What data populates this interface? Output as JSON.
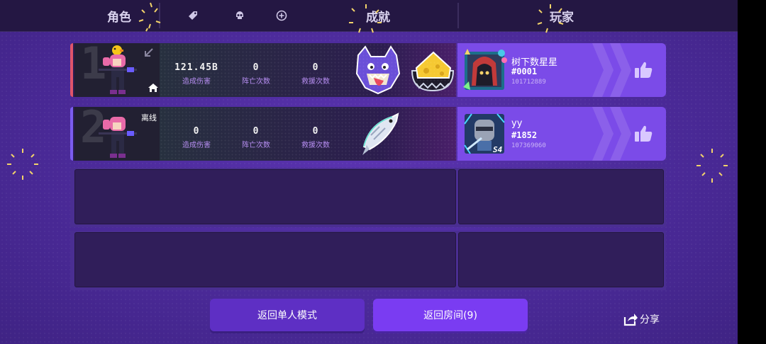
{
  "header": {
    "tabs": [
      {
        "label": "角色",
        "icon": "character-tab"
      },
      {
        "label": "",
        "icon": "tag-icon"
      },
      {
        "label": "",
        "icon": "skull-icon"
      },
      {
        "label": "",
        "icon": "plus-circle-icon"
      },
      {
        "label": "成就",
        "icon": "achievement-tab"
      },
      {
        "label": "玩家",
        "icon": "player-tab"
      }
    ]
  },
  "rows": [
    {
      "rank": "1",
      "status": "",
      "is_host": true,
      "rank_color": "#e0556a",
      "stats": [
        {
          "value": "121.45B",
          "label": "造成伤害"
        },
        {
          "value": "0",
          "label": "阵亡次数"
        },
        {
          "value": "0",
          "label": "救援次数"
        }
      ],
      "achievements": [
        "wolf-badge-icon",
        "cheese-badge-icon"
      ],
      "player": {
        "name": "树下数星星",
        "tag": "#0001",
        "id": "101712889",
        "avatar": "hooded-cat-avatar"
      }
    },
    {
      "rank": "2",
      "status": "离线",
      "is_host": false,
      "rank_color": "#7b5cf0",
      "stats": [
        {
          "value": "0",
          "label": "造成伤害"
        },
        {
          "value": "0",
          "label": "阵亡次数"
        },
        {
          "value": "0",
          "label": "救援次数"
        }
      ],
      "achievements": [
        "fish-badge-icon"
      ],
      "player": {
        "name": "yy",
        "tag": "#1852",
        "id": "107369060",
        "avatar": "knight-helmet-avatar",
        "avatar_badge": "S4"
      }
    }
  ],
  "buttons": {
    "single_mode": "返回单人模式",
    "room": "返回房间(9)",
    "share": "分享"
  },
  "colors": {
    "background": "#4b2a99",
    "header": "#241743",
    "player_panel": "#7b4be8",
    "accent_button": "#7a3cf2"
  }
}
